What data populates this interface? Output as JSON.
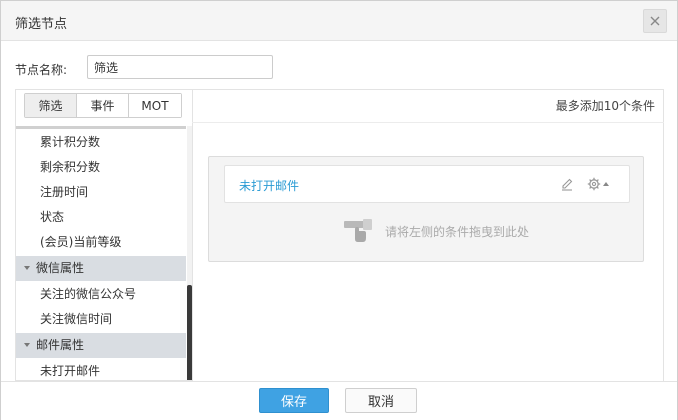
{
  "dialog": {
    "title": "筛选节点",
    "close_icon": "close-icon"
  },
  "node_name": {
    "label": "节点名称:",
    "value": "筛选"
  },
  "tabs": [
    {
      "label": "筛选",
      "active": true
    },
    {
      "label": "事件",
      "active": false
    },
    {
      "label": "MOT",
      "active": false
    }
  ],
  "list": {
    "items": [
      {
        "label": "累计积分数"
      },
      {
        "label": "剩余积分数"
      },
      {
        "label": "注册时间"
      },
      {
        "label": "状态"
      },
      {
        "label": "(会员)当前等级"
      }
    ],
    "group_wechat": {
      "label": "微信属性",
      "icon": "caret-down-icon"
    },
    "wechat_items": [
      {
        "label": "关注的微信公众号"
      },
      {
        "label": "关注微信时间"
      }
    ],
    "group_email": {
      "label": "邮件属性",
      "icon": "caret-down-icon"
    },
    "email_items": [
      {
        "label": "未打开邮件"
      }
    ]
  },
  "right": {
    "limit_text": "最多添加10个条件",
    "condition": {
      "label": "未打开邮件",
      "color": "#2a9bd4"
    },
    "drop_hint": "请将左侧的条件拖曳到此处"
  },
  "footer": {
    "save_label": "保存",
    "cancel_label": "取消",
    "save_color": "#3fa2e3"
  }
}
